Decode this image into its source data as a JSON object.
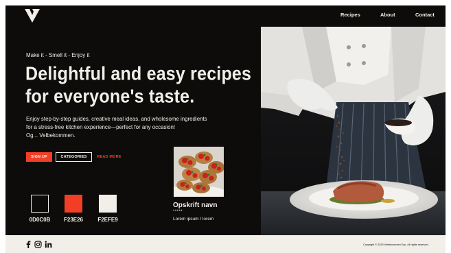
{
  "brand": {
    "logo_icon": "v-logo-icon"
  },
  "nav": {
    "recipes": "Recipes",
    "about": "About",
    "contact": "Contact"
  },
  "hero": {
    "tagline": "Make it - Smell it - Enjoy it",
    "headline": "Delightful and easy recipes for everyone's taste.",
    "description_line1": "Enjoy step-by-step guides, creative meal ideas, and wholesome ingredients",
    "description_line2": "for a stress-free kitchen experience—perfect for any occasion!",
    "description_line3": "Og... Velbekommen.",
    "buttons": {
      "signup": "SIGN UP",
      "categories": "CATEGORIES",
      "read_more": "READ MORE"
    }
  },
  "recipe_card": {
    "name": "Opskrift navn",
    "stars": "*****",
    "subtitle": "Lorem ipsum / lorem"
  },
  "palette": [
    {
      "hex": "#0D0C0B",
      "label": "0D0C0B"
    },
    {
      "hex": "#F23E26",
      "label": "F23E26"
    },
    {
      "hex": "#F2EFE9",
      "label": "F2EFE9"
    }
  ],
  "colors": {
    "dark": "#0D0C0B",
    "accent": "#F23E26",
    "light": "#F2EFE9"
  },
  "footer": {
    "social_icons": [
      "facebook-icon",
      "instagram-icon",
      "linkedin-icon"
    ],
    "copyright": "Copyright © 2025 Velbekommen Exp. All rights reserved."
  }
}
